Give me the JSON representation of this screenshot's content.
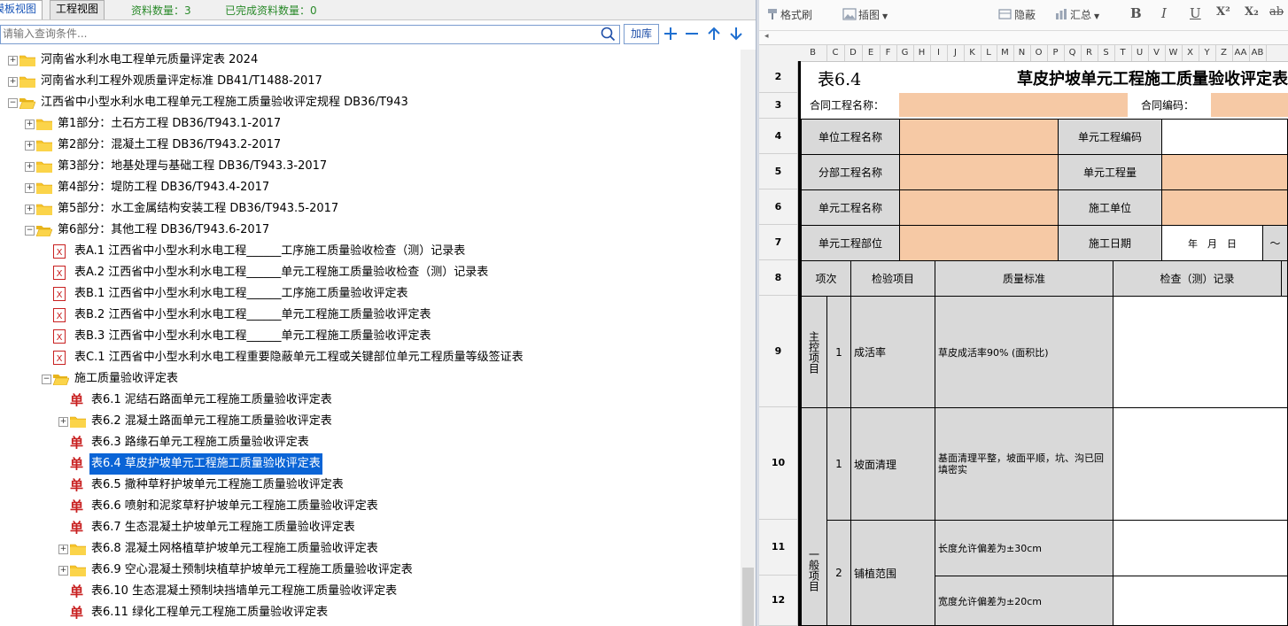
{
  "left": {
    "tabs": [
      "模板视图",
      "工程视图"
    ],
    "count_label": "资料数量：3",
    "done_label": "已完成资料数量：0",
    "search_placeholder": "请输入查询条件...",
    "addlib_label": "加库",
    "tree": [
      {
        "level": 0,
        "icon": "folder",
        "expander": "+",
        "text": "河南省水利水电工程单元质量评定表 2024"
      },
      {
        "level": 0,
        "icon": "folder",
        "expander": "+",
        "text": "河南省水利工程外观质量评定标准 DB41/T1488-2017"
      },
      {
        "level": 0,
        "icon": "folder-open",
        "expander": "-",
        "text": "江西省中小型水利水电工程单元工程施工质量验收评定规程 DB36/T943"
      },
      {
        "level": 1,
        "icon": "folder",
        "expander": "+",
        "text": "第1部分：土石方工程 DB36/T943.1-2017"
      },
      {
        "level": 1,
        "icon": "folder",
        "expander": "+",
        "text": "第2部分：混凝土工程 DB36/T943.2-2017"
      },
      {
        "level": 1,
        "icon": "folder",
        "expander": "+",
        "text": "第3部分：地基处理与基础工程 DB36/T943.3-2017"
      },
      {
        "level": 1,
        "icon": "folder",
        "expander": "+",
        "text": "第4部分：堤防工程 DB36/T943.4-2017"
      },
      {
        "level": 1,
        "icon": "folder",
        "expander": "+",
        "text": "第5部分：水工金属结构安装工程 DB36/T943.5-2017"
      },
      {
        "level": 1,
        "icon": "folder-open",
        "expander": "-",
        "text": "第6部分：其他工程 DB36/T943.6-2017"
      },
      {
        "level": 2,
        "icon": "xls",
        "expander": "",
        "text": "表A.1 江西省中小型水利水电工程______工序施工质量验收检查（测）记录表"
      },
      {
        "level": 2,
        "icon": "xls",
        "expander": "",
        "text": "表A.2 江西省中小型水利水电工程______单元工程施工质量验收检查（测）记录表"
      },
      {
        "level": 2,
        "icon": "xls",
        "expander": "",
        "text": "表B.1 江西省中小型水利水电工程______工序施工质量验收评定表"
      },
      {
        "level": 2,
        "icon": "xls",
        "expander": "",
        "text": "表B.2 江西省中小型水利水电工程______单元工程施工质量验收评定表"
      },
      {
        "level": 2,
        "icon": "xls",
        "expander": "",
        "text": "表B.3 江西省中小型水利水电工程______单元工程施工质量验收评定表"
      },
      {
        "level": 2,
        "icon": "xls",
        "expander": "",
        "text": "表C.1 江西省中小型水利水电工程重要隐蔽单元工程或关键部位单元工程质量等级签证表"
      },
      {
        "level": 2,
        "icon": "folder-open",
        "expander": "-",
        "text": "施工质量验收评定表"
      },
      {
        "level": 3,
        "icon": "dan",
        "expander": "",
        "text": "表6.1 泥结石路面单元工程施工质量验收评定表"
      },
      {
        "level": 3,
        "icon": "folder",
        "expander": "+",
        "text": "表6.2 混凝土路面单元工程施工质量验收评定表"
      },
      {
        "level": 3,
        "icon": "dan",
        "expander": "",
        "text": "表6.3 路缘石单元工程施工质量验收评定表"
      },
      {
        "level": 3,
        "icon": "dan",
        "expander": "",
        "text": "表6.4 草皮护坡单元工程施工质量验收评定表",
        "selected": true
      },
      {
        "level": 3,
        "icon": "dan",
        "expander": "",
        "text": "表6.5 撒种草籽护坡单元工程施工质量验收评定表"
      },
      {
        "level": 3,
        "icon": "dan",
        "expander": "",
        "text": "表6.6 喷射和泥浆草籽护坡单元工程施工质量验收评定表"
      },
      {
        "level": 3,
        "icon": "dan",
        "expander": "",
        "text": "表6.7 生态混凝土护坡单元工程施工质量验收评定表"
      },
      {
        "level": 3,
        "icon": "folder",
        "expander": "+",
        "text": "表6.8 混凝土网格植草护坡单元工程施工质量验收评定表"
      },
      {
        "level": 3,
        "icon": "folder",
        "expander": "+",
        "text": "表6.9 空心混凝土预制块植草护坡单元工程施工质量验收评定表"
      },
      {
        "level": 3,
        "icon": "dan",
        "expander": "",
        "text": "表6.10 生态混凝土预制块挡墙单元工程施工质量验收评定表"
      },
      {
        "level": 3,
        "icon": "dan",
        "expander": "",
        "text": "表6.11 绿化工程单元工程施工质量验收评定表"
      }
    ]
  },
  "right": {
    "toolbar": {
      "format_brush": "格式刷",
      "insert_image": "插图",
      "hide": "隐蔽",
      "summary": "汇总",
      "bold": "B",
      "italic": "I",
      "underline": "U",
      "superscript": "X²",
      "subscript": "X₂",
      "strike": "ab"
    },
    "columns": [
      "B",
      "C",
      "D",
      "E",
      "F",
      "G",
      "H",
      "I",
      "J",
      "K",
      "L",
      "M",
      "N",
      "O",
      "P",
      "Q",
      "R",
      "S",
      "T",
      "U",
      "V",
      "W",
      "X",
      "Y",
      "Z",
      "AA",
      "AB"
    ],
    "rows": [
      "2",
      "3",
      "4",
      "5",
      "6",
      "7",
      "8",
      "9",
      "10",
      "11",
      "12"
    ],
    "sheet": {
      "table_no": "表6.4",
      "title": "草皮护坡单元工程施工质量验收评定表",
      "contract_name_label": "合同工程名称：",
      "contract_code_label": "合同编码：",
      "unit_project_name": "单位工程名称",
      "element_code": "单元工程编码",
      "sub_project_name": "分部工程名称",
      "element_quantity": "单元工程量",
      "element_name": "单元工程名称",
      "construction_unit": "施工单位",
      "element_location": "单元工程部位",
      "construction_date": "施工日期",
      "date_fill": "年　月　日",
      "date_tilde": "～",
      "h_item_no": "项次",
      "h_check_item": "检验项目",
      "h_quality_std": "质量标准",
      "h_record": "检查（测）记录",
      "main_group": "主控项目",
      "general_group": "一般项目",
      "r9_no": "1",
      "r9_item": "成活率",
      "r9_std": "草皮成活率90% (面积比)",
      "r10_no": "1",
      "r10_item": "坡面清理",
      "r10_std": "基面清理平整，坡面平顺，坑、沟已回填密实",
      "r11_no": "2",
      "r11_item": "铺植范围",
      "r11_std": "长度允许偏差为±30cm",
      "r12_std": "宽度允许偏差为±20cm"
    }
  }
}
